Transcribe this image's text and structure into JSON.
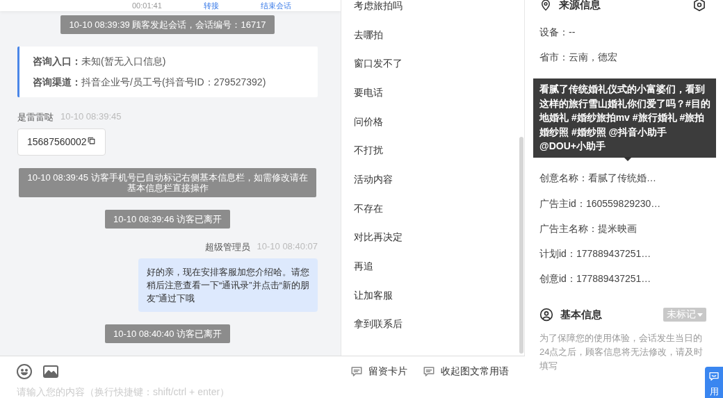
{
  "header": {
    "duration": "00:01:41",
    "actions": [
      "转接",
      "结束会话"
    ]
  },
  "messages": [
    {
      "kind": "system",
      "text": "10-10 08:39:39 顾客发起会话，会话编号：16717"
    },
    {
      "kind": "info",
      "rows": [
        {
          "label": "咨询入口：",
          "value": "未知(暂无入口信息)"
        },
        {
          "label": "咨询渠道：",
          "value": "抖音企业号/员工号(抖音号ID：279527392)"
        }
      ]
    },
    {
      "kind": "visitor",
      "name": "是雷雷哒",
      "time": "10-10 08:39:45",
      "text": "15687560002"
    },
    {
      "kind": "system",
      "text": "10-10 08:39:45 访客手机号已自动标记右侧基本信息栏，如需修改请在基本信息栏直接操作"
    },
    {
      "kind": "system",
      "text": "10-10 08:39:46 访客已离开"
    },
    {
      "kind": "agent",
      "name": "超级管理员",
      "time": "10-10 08:40:07",
      "text": "好的亲，现在安排客服加您介绍哈。请您稍后注意查看一下“通讯录”并点击“新的朋友”通过下哦"
    },
    {
      "kind": "system",
      "text": "10-10 08:40:40 访客已离开"
    }
  ],
  "phrases": [
    "考虑旅拍吗",
    "去哪拍",
    "窗口发不了",
    "要电话",
    "问价格",
    "不打扰",
    "活动内容",
    "不存在",
    "对比再决定",
    "再追",
    "让加客服",
    "拿到联系后"
  ],
  "toolbar": {
    "actions": [
      "留资卡片",
      "收起图文常用语"
    ]
  },
  "input": {
    "placeholder": "请输入您的内容（换行快捷键：shift/ctrl + enter）"
  },
  "source": {
    "title": "来源信息",
    "rows_top": [
      "设备：--",
      "省市：云南，德宏"
    ],
    "rows_bottom": [
      "创意名称：看腻了传统婚…",
      "广告主id：160559829230…",
      "广告主名称：提米映画",
      "计划id：177889437251…",
      "创意id：177889437251…"
    ]
  },
  "tooltip": {
    "text": "看腻了传统婚礼仪式的小富婆们，看到这样的旅行雪山婚礼你们爱了吗？#目的地婚礼 #婚纱旅拍mv #旅行婚礼 #旅拍婚纱照 #婚纱照 @抖音小助手 @DOU+小助手"
  },
  "basic": {
    "title": "基本信息",
    "tag": "未标记",
    "note": "为了保障您的使用体验，会话发生当日的24点之后，顾客信息将无法修改，请及时填写"
  },
  "side_tab": {
    "label": "用"
  }
}
